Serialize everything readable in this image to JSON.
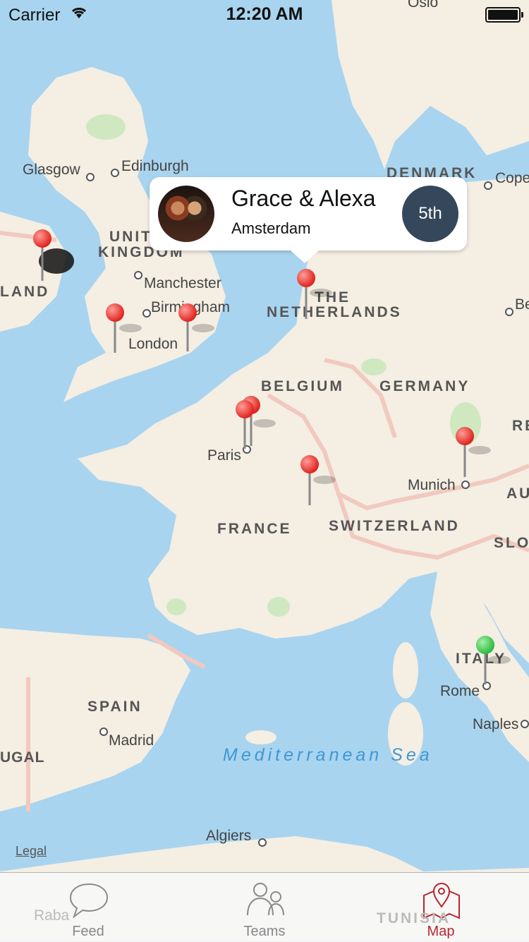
{
  "status": {
    "carrier": "Carrier",
    "time": "12:20 AM"
  },
  "callout": {
    "name": "Grace & Alexa",
    "place": "Amsterdam",
    "rank": "5th"
  },
  "map_labels": {
    "oslo": "Oslo",
    "glasgow": "Glasgow",
    "edinburgh": "Edinburgh",
    "denmark": "DENMARK",
    "cope": "Cope",
    "united": "UNITED",
    "kingdom": "KINGDOM",
    "land": "LAND",
    "manchester": "Manchester",
    "birmingham": "Birmingham",
    "london": "London",
    "the": "THE",
    "netherlands": "NETHERLANDS",
    "be": "Be",
    "belgium": "BELGIUM",
    "germany": "GERMANY",
    "re": "RE",
    "paris": "Paris",
    "munich": "Munich",
    "au": "AU",
    "france": "FRANCE",
    "switzerland": "SWITZERLAND",
    "slo": "SLO",
    "italy": "ITALY",
    "rome": "Rome",
    "spain": "SPAIN",
    "madrid": "Madrid",
    "naples": "Naples",
    "ugal": "UGAL",
    "sea": "Mediterranean Sea",
    "algiers": "Algiers",
    "tunisia": "TUNISIA",
    "raba": "Raba"
  },
  "legal": "Legal",
  "tabs": [
    {
      "label": "Feed",
      "icon": "speech-bubble-icon"
    },
    {
      "label": "Teams",
      "icon": "people-icon"
    },
    {
      "label": "Map",
      "icon": "map-pin-icon"
    }
  ],
  "colors": {
    "pin_red": "#f23c37",
    "pin_green": "#3fcf4f",
    "accent": "#b8262d",
    "rank_bg": "#34475b"
  }
}
